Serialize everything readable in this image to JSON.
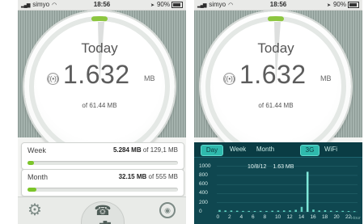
{
  "status": {
    "carrier": "simyo",
    "time": "18:56",
    "battery": "90%"
  },
  "left": {
    "dial": {
      "title": "Today",
      "value": "1.632",
      "unit": "MB",
      "of_text": "of 61.44 MB",
      "progress": 0.0266
    },
    "cards": [
      {
        "label": "Week",
        "value": "5.284 MB",
        "of": "of 129,1 MB",
        "fraction": 0.041
      },
      {
        "label": "Month",
        "value": "32.15 MB",
        "of": "of 555 MB",
        "fraction": 0.058
      }
    ],
    "bottom_icons": [
      "gear-icon",
      "phone-icon",
      "map-pin-icon"
    ]
  },
  "right": {
    "dial": {
      "title": "Today",
      "value": "1.632",
      "unit": "MB",
      "of_text": "of 61.44 MB",
      "progress": 0.0266
    },
    "tabs": {
      "day": "Day",
      "week": "Week",
      "month": "Month",
      "g3": "3G",
      "wifi": "WiFi"
    },
    "selection": {
      "date": "10/8/12",
      "value": "1.63 MB"
    },
    "hour_label": "Hour"
  },
  "chart_data": {
    "type": "bar",
    "y_tick_labels": [
      "1000",
      "800",
      "600",
      "400",
      "200",
      "0"
    ],
    "ylim": [
      0,
      1100
    ],
    "x_tick_labels": [
      "0",
      "2",
      "4",
      "6",
      "8",
      "10",
      "12",
      "14",
      "16",
      "18",
      "20",
      "22"
    ],
    "x": [
      0,
      1,
      2,
      3,
      4,
      5,
      6,
      7,
      8,
      9,
      10,
      11,
      12,
      13,
      14,
      15,
      16,
      17,
      18,
      19,
      20,
      21,
      22,
      23
    ],
    "values": [
      40,
      30,
      30,
      25,
      20,
      20,
      18,
      22,
      20,
      25,
      28,
      30,
      32,
      45,
      110,
      880,
      50,
      30,
      35,
      25,
      20,
      22,
      18,
      15
    ],
    "highlight_index": 15,
    "xlabel": "Hour",
    "grid": true
  }
}
